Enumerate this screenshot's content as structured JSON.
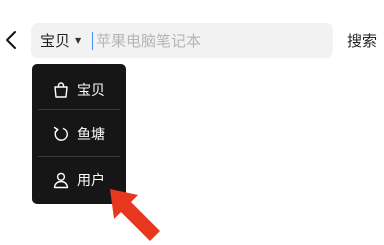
{
  "search": {
    "scope": "宝贝",
    "placeholder": "苹果电脑笔记本",
    "submit_label": "搜索"
  },
  "dropdown": {
    "items": [
      {
        "label": "宝贝",
        "icon": "shopping-bag-icon"
      },
      {
        "label": "鱼塘",
        "icon": "fish-pond-icon"
      },
      {
        "label": "用户",
        "icon": "user-icon"
      }
    ]
  },
  "colors": {
    "menu_bg": "#161616",
    "search_bg": "#f2f2f2",
    "cursor": "#4a8df0",
    "annotation_arrow": "#e8371f"
  }
}
